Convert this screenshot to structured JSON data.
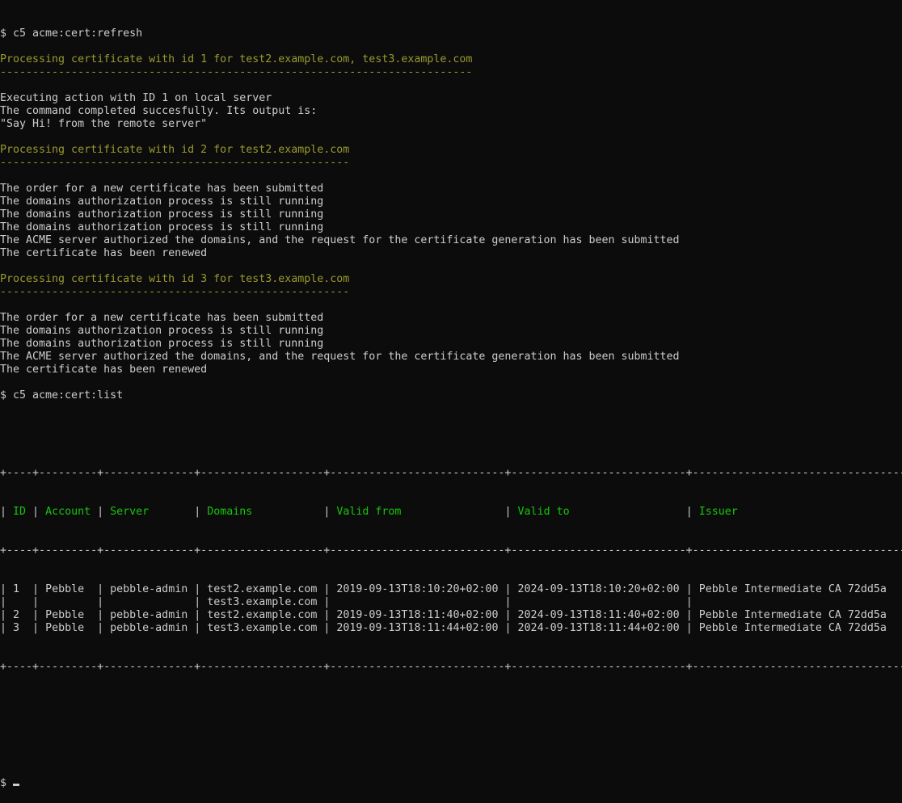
{
  "terminal": {
    "lines": [
      {
        "color": "w",
        "text": "$ c5 acme:cert:refresh"
      },
      {
        "color": "w",
        "text": ""
      },
      {
        "color": "y",
        "text": "Processing certificate with id 1 for test2.example.com, test3.example.com"
      },
      {
        "color": "y",
        "text": "-------------------------------------------------------------------------"
      },
      {
        "color": "w",
        "text": ""
      },
      {
        "color": "w",
        "text": "Executing action with ID 1 on local server"
      },
      {
        "color": "w",
        "text": "The command completed succesfully. Its output is:"
      },
      {
        "color": "w",
        "text": "\"Say Hi! from the remote server\""
      },
      {
        "color": "w",
        "text": ""
      },
      {
        "color": "y",
        "text": "Processing certificate with id 2 for test2.example.com"
      },
      {
        "color": "y",
        "text": "------------------------------------------------------"
      },
      {
        "color": "w",
        "text": ""
      },
      {
        "color": "w",
        "text": "The order for a new certificate has been submitted"
      },
      {
        "color": "w",
        "text": "The domains authorization process is still running"
      },
      {
        "color": "w",
        "text": "The domains authorization process is still running"
      },
      {
        "color": "w",
        "text": "The domains authorization process is still running"
      },
      {
        "color": "w",
        "text": "The ACME server authorized the domains, and the request for the certificate generation has been submitted"
      },
      {
        "color": "w",
        "text": "The certificate has been renewed"
      },
      {
        "color": "w",
        "text": ""
      },
      {
        "color": "y",
        "text": "Processing certificate with id 3 for test3.example.com"
      },
      {
        "color": "y",
        "text": "------------------------------------------------------"
      },
      {
        "color": "w",
        "text": ""
      },
      {
        "color": "w",
        "text": "The order for a new certificate has been submitted"
      },
      {
        "color": "w",
        "text": "The domains authorization process is still running"
      },
      {
        "color": "w",
        "text": "The domains authorization process is still running"
      },
      {
        "color": "w",
        "text": "The ACME server authorized the domains, and the request for the certificate generation has been submitted"
      },
      {
        "color": "w",
        "text": "The certificate has been renewed"
      },
      {
        "color": "w",
        "text": ""
      },
      {
        "color": "w",
        "text": "$ c5 acme:cert:list"
      }
    ],
    "table": {
      "border": "+----+---------+--------------+-------------------+---------------------------+---------------------------+-----------------------------------+",
      "headers": [
        "ID",
        "Account",
        "Server",
        "Domains",
        "Valid from",
        "Valid to",
        "Issuer"
      ],
      "widths": [
        2,
        7,
        12,
        17,
        25,
        25,
        33
      ],
      "rows": [
        [
          "1",
          "Pebble",
          "pebble-admin",
          "test2.example.com",
          "2019-09-13T18:10:20+02:00",
          "2024-09-13T18:10:20+02:00",
          "Pebble Intermediate CA 72dd5a"
        ],
        [
          "",
          "",
          "",
          "test3.example.com",
          "",
          "",
          ""
        ],
        [
          "2",
          "Pebble",
          "pebble-admin",
          "test2.example.com",
          "2019-09-13T18:11:40+02:00",
          "2024-09-13T18:11:40+02:00",
          "Pebble Intermediate CA 72dd5a"
        ],
        [
          "3",
          "Pebble",
          "pebble-admin",
          "test3.example.com",
          "2019-09-13T18:11:44+02:00",
          "2024-09-13T18:11:44+02:00",
          "Pebble Intermediate CA 72dd5a"
        ]
      ]
    },
    "prompt": "$ "
  },
  "colors": {
    "background": "#0c0c0c",
    "text": "#cccccc",
    "heading": "#9a9a2e",
    "table_header": "#16c60c"
  }
}
